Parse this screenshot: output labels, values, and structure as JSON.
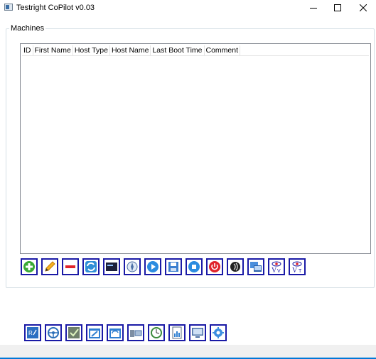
{
  "window": {
    "title": "Testright CoPilot v0.03",
    "controls": [
      "minimize",
      "maximize",
      "close"
    ]
  },
  "machines": {
    "group_label": "Machines",
    "columns": [
      "ID",
      "First Name",
      "Host Type",
      "Host Name",
      "Last Boot Time",
      "Comment"
    ],
    "rows": []
  },
  "toolbar_main": [
    {
      "name": "add-icon"
    },
    {
      "name": "edit-pencil-icon"
    },
    {
      "name": "remove-icon"
    },
    {
      "name": "refresh-icon"
    },
    {
      "name": "terminal-icon"
    },
    {
      "name": "compass-icon"
    },
    {
      "name": "play-icon"
    },
    {
      "name": "save-icon"
    },
    {
      "name": "stop-icon"
    },
    {
      "name": "power-icon"
    },
    {
      "name": "broadcast-icon"
    },
    {
      "name": "remote-desktop-icon"
    },
    {
      "name": "view-v-icon"
    },
    {
      "name": "view-vt-icon"
    }
  ],
  "toolbar_bottom": [
    {
      "name": "ra-icon"
    },
    {
      "name": "steering-wheel-icon"
    },
    {
      "name": "selenium-check-icon"
    },
    {
      "name": "calendar-edit-icon"
    },
    {
      "name": "calendar-sync-icon"
    },
    {
      "name": "network-host-icon"
    },
    {
      "name": "clock-icon"
    },
    {
      "name": "report-icon"
    },
    {
      "name": "monitor-icon"
    },
    {
      "name": "settings-gear-icon"
    }
  ],
  "colors": {
    "button_border": "#1a1aa6",
    "accent": "#0078d7"
  }
}
